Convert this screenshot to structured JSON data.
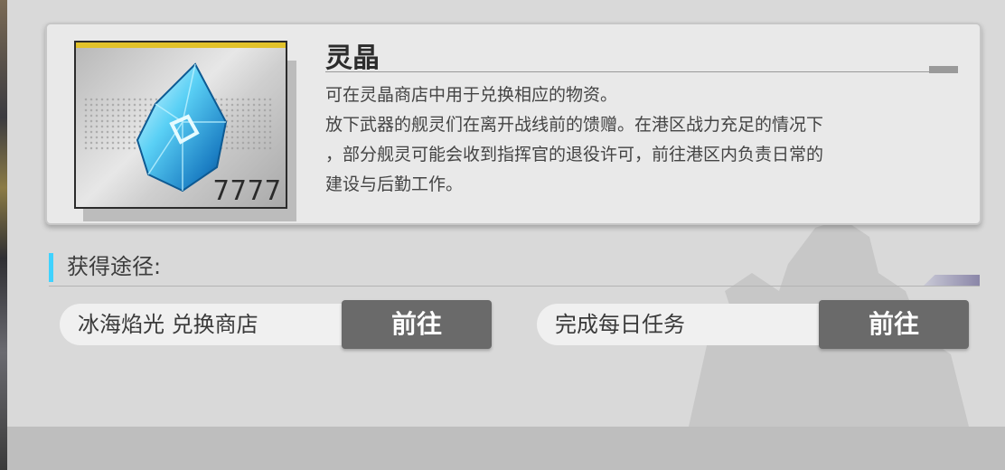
{
  "item": {
    "name": "灵晶",
    "count": "7777",
    "description": [
      "可在灵晶商店中用于兑换相应的物资。",
      "放下武器的舰灵们在离开战线前的馈赠。在港区战力充足的情况下",
      "，部分舰灵可能会收到指挥官的退役许可，前往港区内负责日常的",
      "建设与后勤工作。"
    ],
    "icon": "blue-crystal-icon",
    "frame_color": "#e2c22a"
  },
  "acquire": {
    "title": "获得途径:",
    "accent_color": "#3fd2ff",
    "routes": [
      {
        "label": "冰海焰光 兑换商店",
        "button": "前往"
      },
      {
        "label": "完成每日任务",
        "button": "前往"
      }
    ]
  }
}
